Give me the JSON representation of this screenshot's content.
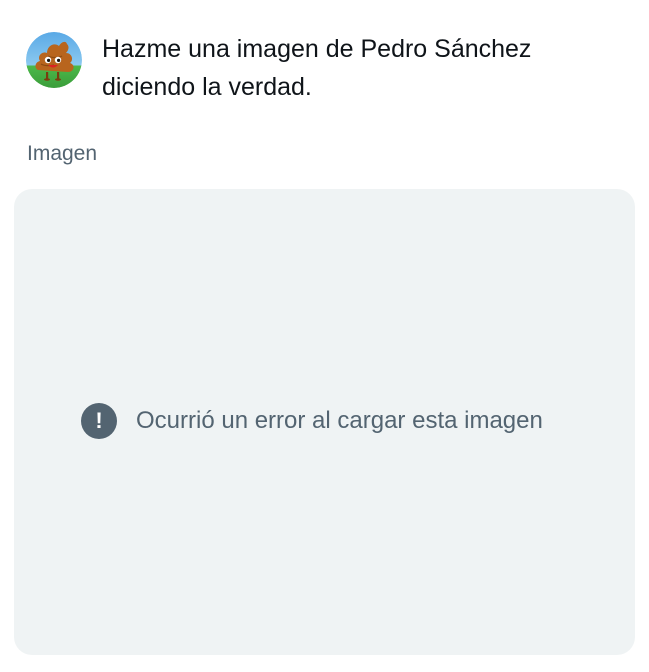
{
  "message": {
    "avatar_icon": "cartoon-poop-character-avatar",
    "text": "Hazme una imagen de Pedro Sánchez diciendo la verdad."
  },
  "image_section": {
    "label": "Imagen",
    "error_icon": "exclamation-circle-icon",
    "error_text": "Ocurrió un error al cargar esta imagen"
  },
  "colors": {
    "primary_text": "#0f1419",
    "secondary_text": "#536471",
    "card_background": "#eff3f4"
  }
}
